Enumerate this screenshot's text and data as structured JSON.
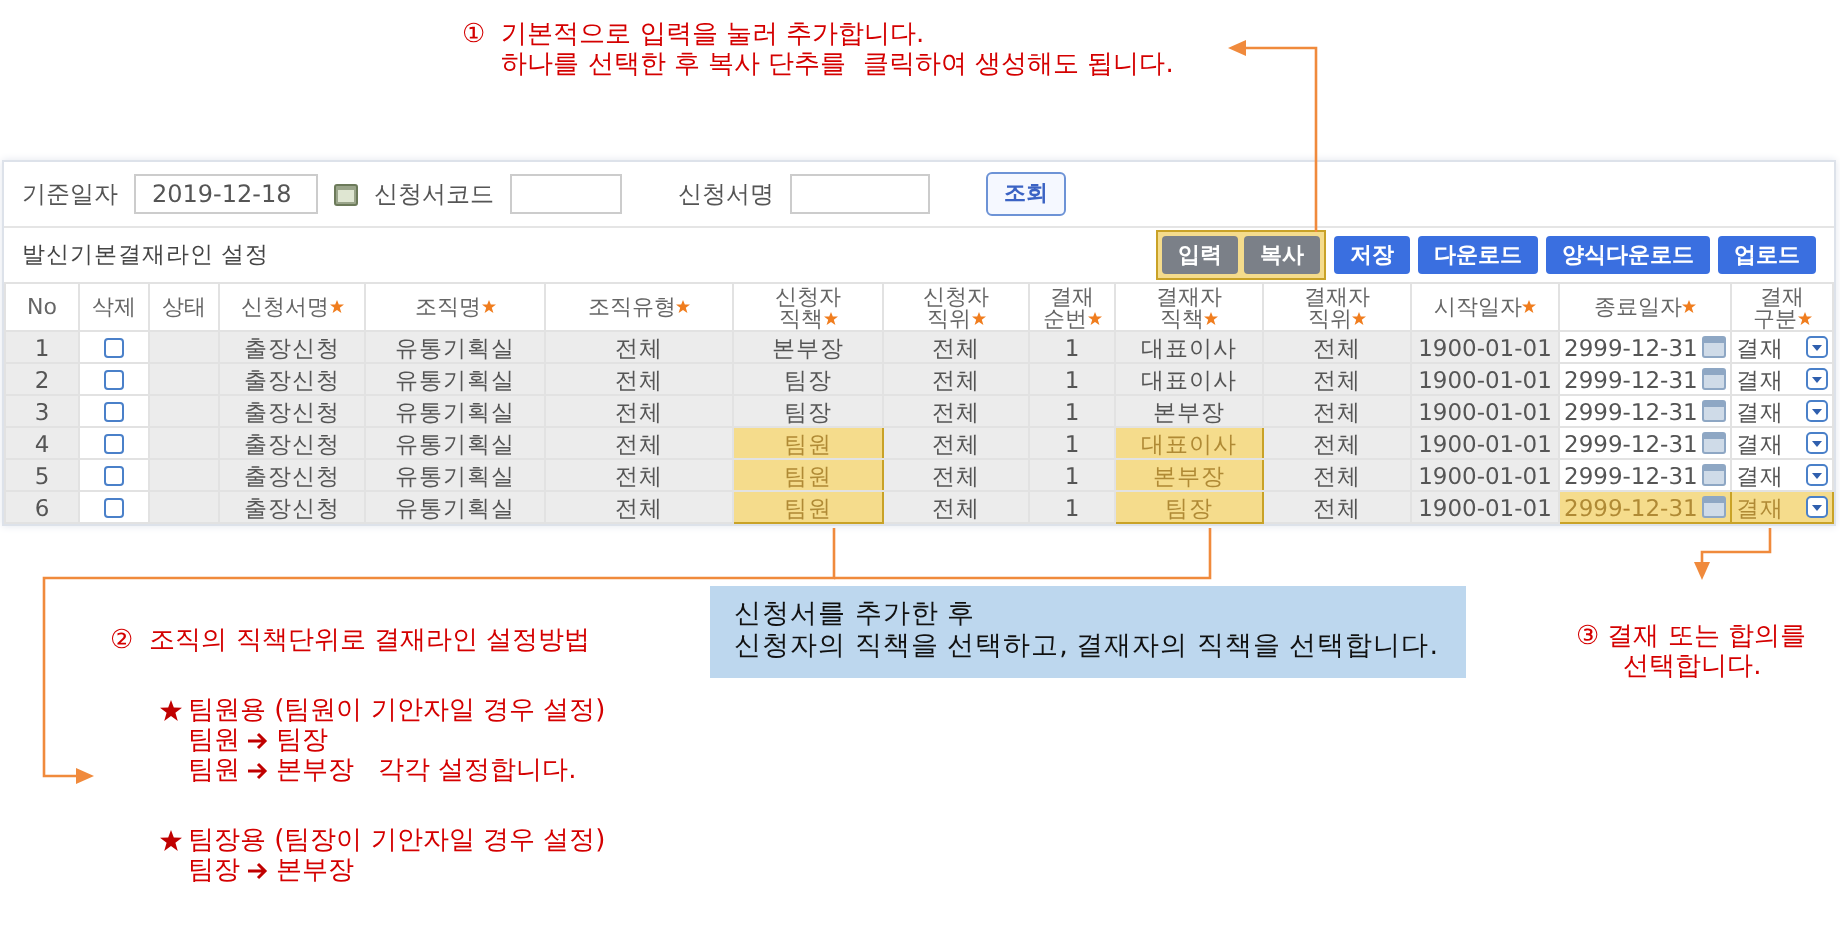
{
  "notes": [
    {
      "number": "①",
      "lines": [
        "기본적으로 입력을 눌러 추가합니다.",
        "하나를 선택한 후 복사 단추를  클릭하여 생성해도 됩니다."
      ]
    }
  ],
  "search": {
    "fields": [
      {
        "label": "기준일자",
        "value": "2019-12-18",
        "kind": "date"
      },
      {
        "label": "신청서코드",
        "kind": "text"
      },
      {
        "label": "신청서명",
        "kind": "text"
      }
    ],
    "button": "조회"
  },
  "section": {
    "title": "발신기본결재라인 설정",
    "buttons": [
      {
        "label": "입력",
        "kind": "grey",
        "highlighted": true
      },
      {
        "label": "복사",
        "kind": "grey",
        "highlighted": true
      },
      {
        "label": "저장",
        "kind": "blue",
        "highlighted": false
      },
      {
        "label": "다운로드",
        "kind": "blue",
        "highlighted": false
      },
      {
        "label": "양식다운로드",
        "kind": "blue",
        "highlighted": false
      },
      {
        "label": "업로드",
        "kind": "blue",
        "highlighted": false
      }
    ]
  },
  "table": {
    "columns": [
      {
        "lines": [
          "No"
        ],
        "required": false
      },
      {
        "lines": [
          "삭제"
        ],
        "required": false
      },
      {
        "lines": [
          "상태"
        ],
        "required": false
      },
      {
        "lines": [
          "신청서명"
        ],
        "required": true
      },
      {
        "lines": [
          "조직명"
        ],
        "required": true
      },
      {
        "lines": [
          "조직유형"
        ],
        "required": true
      },
      {
        "lines": [
          "신청자",
          "직책"
        ],
        "required": true
      },
      {
        "lines": [
          "신청자",
          "직위"
        ],
        "required": true
      },
      {
        "lines": [
          "결재",
          "순번"
        ],
        "required": true
      },
      {
        "lines": [
          "결재자",
          "직책"
        ],
        "required": true
      },
      {
        "lines": [
          "결재자",
          "직위"
        ],
        "required": true
      },
      {
        "lines": [
          "시작일자"
        ],
        "required": true
      },
      {
        "lines": [
          "종료일자"
        ],
        "required": true
      },
      {
        "lines": [
          "결재",
          "구분"
        ],
        "required": true
      }
    ],
    "rows": [
      {
        "cells": [
          {
            "kind": "text",
            "text": "1"
          },
          {
            "kind": "checkbox",
            "checked": false
          },
          {
            "kind": "blank"
          },
          {
            "kind": "text",
            "text": "출장신청"
          },
          {
            "kind": "text",
            "text": "유통기획실"
          },
          {
            "kind": "text",
            "text": "전체"
          },
          {
            "kind": "text",
            "text": "본부장",
            "highlighted": false
          },
          {
            "kind": "text",
            "text": "전체"
          },
          {
            "kind": "text",
            "text": "1"
          },
          {
            "kind": "text",
            "text": "대표이사",
            "highlighted": false
          },
          {
            "kind": "text",
            "text": "전체"
          },
          {
            "kind": "text",
            "text": "1900-01-01"
          },
          {
            "kind": "date",
            "text": "2999-12-31",
            "highlighted": false
          },
          {
            "kind": "select",
            "text": "결재",
            "highlighted": false
          }
        ]
      },
      {
        "cells": [
          {
            "kind": "text",
            "text": "2"
          },
          {
            "kind": "checkbox",
            "checked": false
          },
          {
            "kind": "blank"
          },
          {
            "kind": "text",
            "text": "출장신청"
          },
          {
            "kind": "text",
            "text": "유통기획실"
          },
          {
            "kind": "text",
            "text": "전체"
          },
          {
            "kind": "text",
            "text": "팀장",
            "highlighted": false
          },
          {
            "kind": "text",
            "text": "전체"
          },
          {
            "kind": "text",
            "text": "1"
          },
          {
            "kind": "text",
            "text": "대표이사",
            "highlighted": false
          },
          {
            "kind": "text",
            "text": "전체"
          },
          {
            "kind": "text",
            "text": "1900-01-01"
          },
          {
            "kind": "date",
            "text": "2999-12-31",
            "highlighted": false
          },
          {
            "kind": "select",
            "text": "결재",
            "highlighted": false
          }
        ]
      },
      {
        "cells": [
          {
            "kind": "text",
            "text": "3"
          },
          {
            "kind": "checkbox",
            "checked": false
          },
          {
            "kind": "blank"
          },
          {
            "kind": "text",
            "text": "출장신청"
          },
          {
            "kind": "text",
            "text": "유통기획실"
          },
          {
            "kind": "text",
            "text": "전체"
          },
          {
            "kind": "text",
            "text": "팀장",
            "highlighted": false
          },
          {
            "kind": "text",
            "text": "전체"
          },
          {
            "kind": "text",
            "text": "1"
          },
          {
            "kind": "text",
            "text": "본부장",
            "highlighted": false
          },
          {
            "kind": "text",
            "text": "전체"
          },
          {
            "kind": "text",
            "text": "1900-01-01"
          },
          {
            "kind": "date",
            "text": "2999-12-31",
            "highlighted": false
          },
          {
            "kind": "select",
            "text": "결재",
            "highlighted": false
          }
        ]
      },
      {
        "cells": [
          {
            "kind": "text",
            "text": "4"
          },
          {
            "kind": "checkbox",
            "checked": false
          },
          {
            "kind": "blank"
          },
          {
            "kind": "text",
            "text": "출장신청"
          },
          {
            "kind": "text",
            "text": "유통기획실"
          },
          {
            "kind": "text",
            "text": "전체"
          },
          {
            "kind": "text",
            "text": "팀원",
            "highlighted": true
          },
          {
            "kind": "text",
            "text": "전체"
          },
          {
            "kind": "text",
            "text": "1"
          },
          {
            "kind": "text",
            "text": "대표이사",
            "highlighted": true
          },
          {
            "kind": "text",
            "text": "전체"
          },
          {
            "kind": "text",
            "text": "1900-01-01"
          },
          {
            "kind": "date",
            "text": "2999-12-31",
            "highlighted": false
          },
          {
            "kind": "select",
            "text": "결재",
            "highlighted": false
          }
        ]
      },
      {
        "cells": [
          {
            "kind": "text",
            "text": "5"
          },
          {
            "kind": "checkbox",
            "checked": false
          },
          {
            "kind": "blank"
          },
          {
            "kind": "text",
            "text": "출장신청"
          },
          {
            "kind": "text",
            "text": "유통기획실"
          },
          {
            "kind": "text",
            "text": "전체"
          },
          {
            "kind": "text",
            "text": "팀원",
            "highlighted": true
          },
          {
            "kind": "text",
            "text": "전체"
          },
          {
            "kind": "text",
            "text": "1"
          },
          {
            "kind": "text",
            "text": "본부장",
            "highlighted": true
          },
          {
            "kind": "text",
            "text": "전체"
          },
          {
            "kind": "text",
            "text": "1900-01-01"
          },
          {
            "kind": "date",
            "text": "2999-12-31",
            "highlighted": false
          },
          {
            "kind": "select",
            "text": "결재",
            "highlighted": false
          }
        ]
      },
      {
        "cells": [
          {
            "kind": "text",
            "text": "6"
          },
          {
            "kind": "checkbox",
            "checked": false
          },
          {
            "kind": "blank"
          },
          {
            "kind": "text",
            "text": "출장신청"
          },
          {
            "kind": "text",
            "text": "유통기획실"
          },
          {
            "kind": "text",
            "text": "전체"
          },
          {
            "kind": "text",
            "text": "팀원",
            "highlighted": true
          },
          {
            "kind": "text",
            "text": "전체"
          },
          {
            "kind": "text",
            "text": "1"
          },
          {
            "kind": "text",
            "text": "팀장",
            "highlighted": true
          },
          {
            "kind": "text",
            "text": "전체"
          },
          {
            "kind": "text",
            "text": "1900-01-01"
          },
          {
            "kind": "date",
            "text": "2999-12-31",
            "highlighted": true
          },
          {
            "kind": "select",
            "text": "결재",
            "highlighted": true
          }
        ]
      }
    ]
  },
  "method_note": {
    "number": "②",
    "title": "조직의 직책단위로 결재라인 설정방법",
    "groups": [
      {
        "heading": "팀원용 (팀원이 기안자일 경우 설정)",
        "lines": [
          {
            "from": "팀원",
            "to": "팀장"
          },
          {
            "from": "팀원",
            "to": "본부장",
            "suffix": "각각 설정합니다."
          }
        ]
      },
      {
        "heading": "팀장용 (팀장이 기안자일 경우 설정)",
        "lines": [
          {
            "from": "팀장",
            "to": "본부장"
          }
        ]
      }
    ]
  },
  "info_box": {
    "lines": [
      "신청서를 추가한 후",
      "신청자의 직책을 선택하고, 결재자의 직책을 선택합니다."
    ]
  },
  "choice_note": {
    "number": "③",
    "lines": [
      "결재 또는 합의를",
      "선택합니다."
    ]
  }
}
